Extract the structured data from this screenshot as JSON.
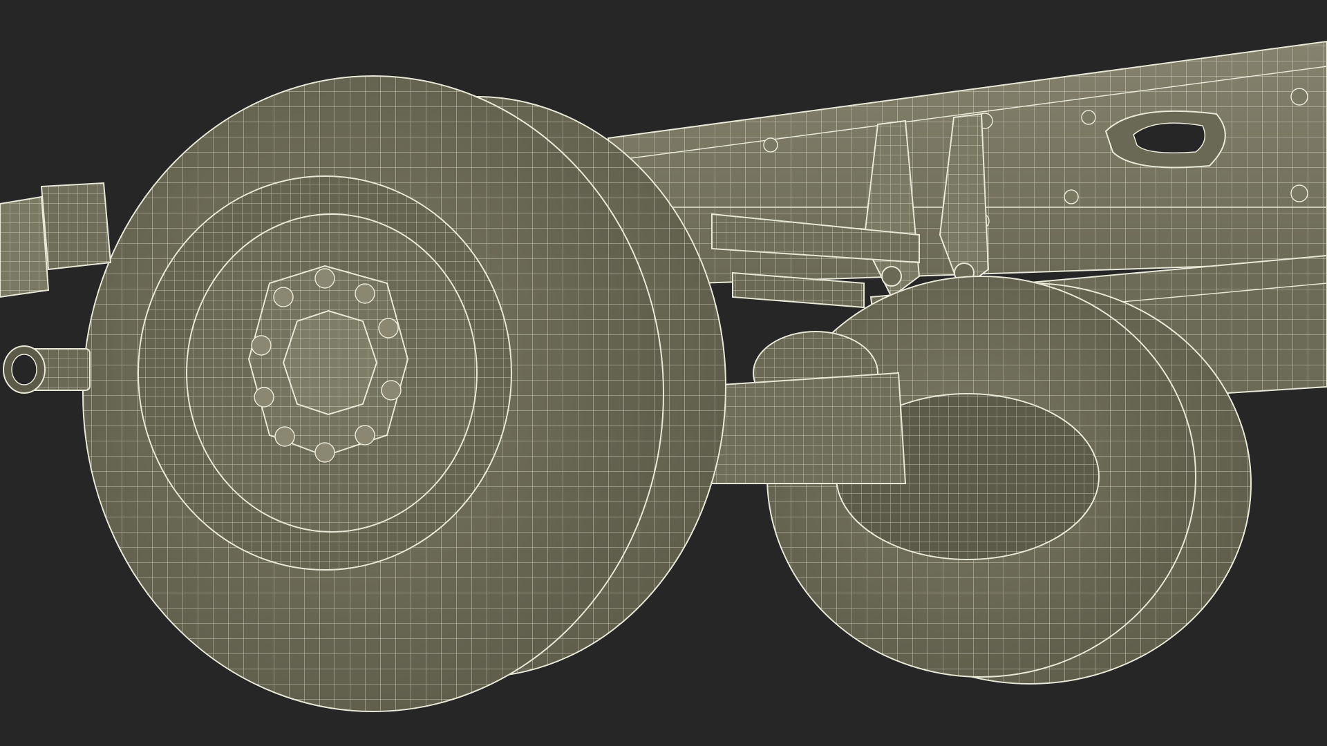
{
  "scene": {
    "subject": "truck-rear-axle-wireframe",
    "background_color": "#262626",
    "surface_color": "#74735f",
    "surface_shadow_color": "#5c5b4a",
    "surface_light_color": "#8a8872",
    "wire_color": "#e8e8d8",
    "render_mode": "wireframe-over-shaded"
  }
}
